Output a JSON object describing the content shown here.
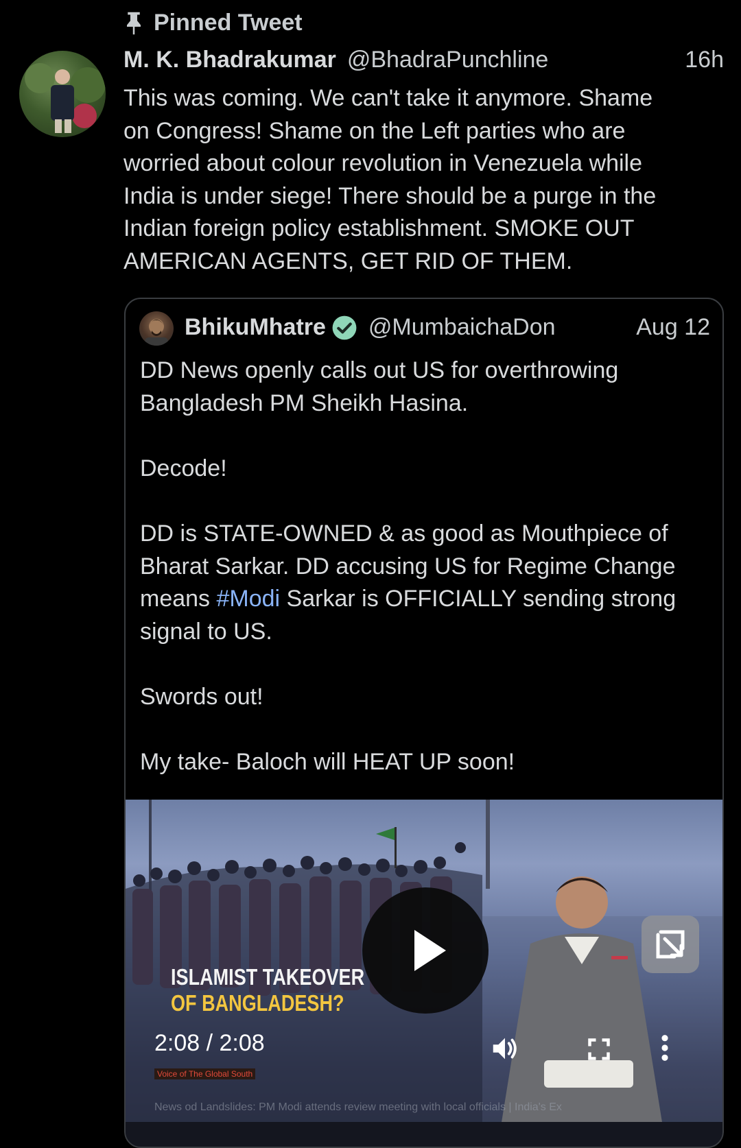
{
  "pinned_label": "Pinned Tweet",
  "tweet": {
    "author_name": "M. K. Bhadrakumar",
    "author_handle": "@BhadraPunchline",
    "time": "16h",
    "text": "This was coming. We can't take it anymore. Shame\non Congress! Shame on the Left parties who are\nworried about colour revolution in Venezuela while\nIndia is under siege! There should be a purge in the\nIndian foreign policy establishment. SMOKE OUT\nAMERICAN AGENTS, GET RID OF THEM."
  },
  "quoted_tweet": {
    "author_name": "BhikuMhatre",
    "author_handle": "@MumbaichaDon",
    "time": "Aug 12",
    "para1": "DD News openly calls out US for overthrowing\nBangladesh PM Sheikh Hasina.",
    "para2": "Decode!",
    "para3_before": "DD is STATE-OWNED & as good as Mouthpiece of\nBharat Sarkar. DD accusing US for Regime Change\nmeans ",
    "para3_hashtag": "#Modi",
    "para3_after": " Sarkar is OFFICIALLY sending strong\nsignal to US.",
    "para4": "Swords out!",
    "para5": "My take- Baloch will HEAT UP soon!"
  },
  "video": {
    "headline_line1": "ISLAMIST TAKEOVER",
    "headline_line2": "OF BANGLADESH?",
    "timecode": "2:08 / 2:08",
    "ticker_label": "Voice of The Global South",
    "ticker_text": "News    od Landslides: PM Modi attends review meeting with local officials  |  India's Ex",
    "colors": {
      "headline_white": "#f4f4f4",
      "headline_yellow": "#f3c640"
    }
  },
  "icons": {
    "pin": "pin-icon",
    "verified": "verified-badge-icon",
    "play": "play-icon",
    "pip": "picture-in-picture-icon",
    "volume": "volume-icon",
    "fullscreen": "fullscreen-icon",
    "more": "more-options-icon"
  },
  "accent_colors": {
    "hashtag": "#8ab4f8",
    "verified": "#8fd6b8"
  }
}
